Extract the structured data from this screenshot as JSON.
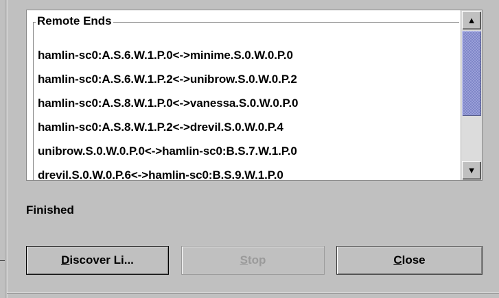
{
  "remote_ends": {
    "title": "Remote Ends",
    "items": [
      "hamlin-sc0:A.S.6.W.1.P.0<->minime.S.0.W.0.P.0",
      "hamlin-sc0:A.S.6.W.1.P.2<->unibrow.S.0.W.0.P.2",
      "hamlin-sc0:A.S.8.W.1.P.0<->vanessa.S.0.W.0.P.0",
      "hamlin-sc0:A.S.8.W.1.P.2<->drevil.S.0.W.0.P.4",
      "unibrow.S.0.W.0.P.0<->hamlin-sc0:B.S.7.W.1.P.0",
      "drevil.S.0.W.0.P.6<->hamlin-sc0:B.S.9.W.1.P.0"
    ]
  },
  "status_text": "Finished",
  "buttons": {
    "discover": {
      "mnemonic": "D",
      "rest": "iscover Li..."
    },
    "stop": {
      "mnemonic": "S",
      "rest": "top",
      "enabled": false
    },
    "close": {
      "mnemonic": "C",
      "rest": "lose"
    }
  },
  "icons": {
    "scroll_up": "arrow-up-icon",
    "scroll_down": "arrow-down-icon"
  },
  "colors": {
    "background": "#c0c0c0",
    "thumb": "#9aa0d8",
    "disabled_text": "#9a9a9a"
  }
}
